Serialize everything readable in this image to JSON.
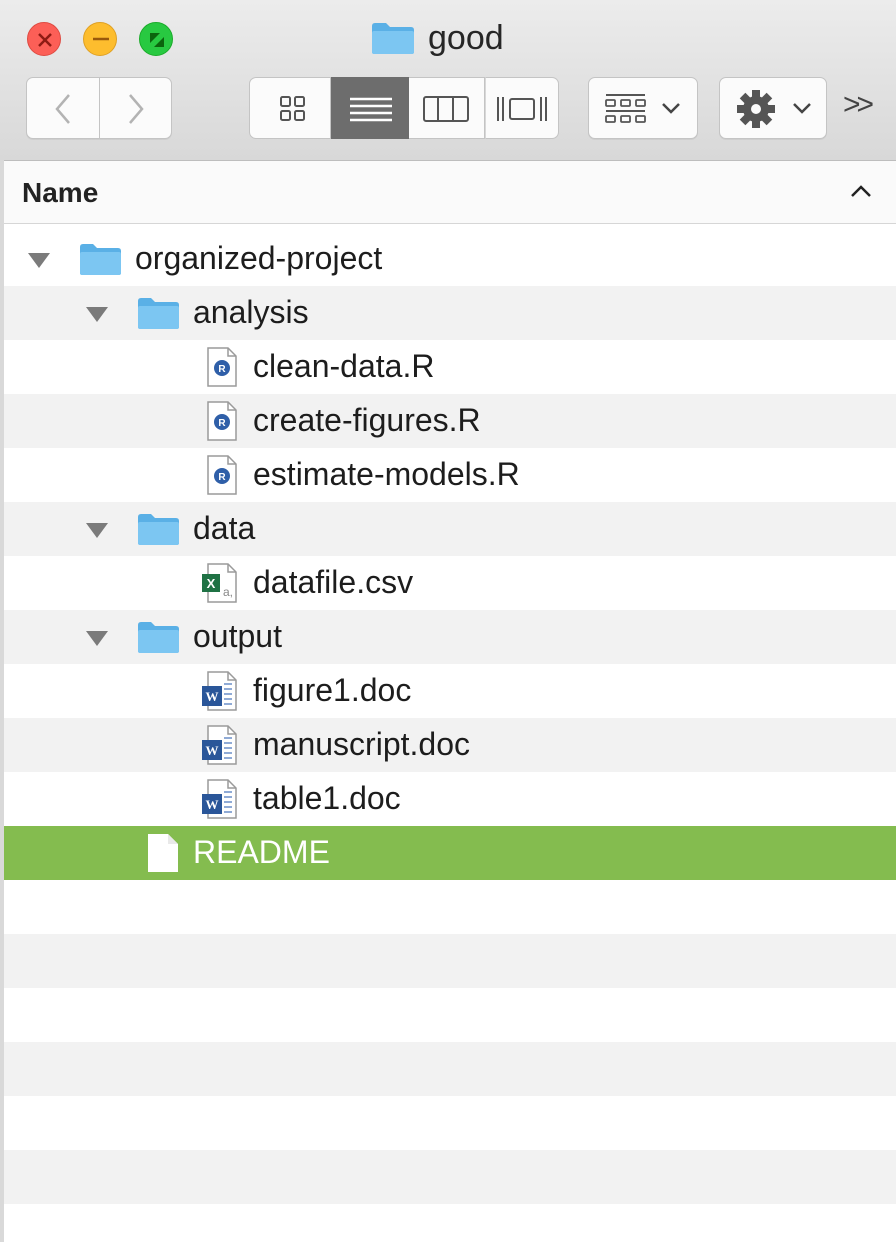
{
  "window": {
    "title": "good",
    "title_icon": "folder-icon",
    "traffic_lights": [
      "close",
      "minimize",
      "zoom"
    ]
  },
  "toolbar": {
    "back_icon": "chevron-left-icon",
    "forward_icon": "chevron-right-icon",
    "view_modes": [
      "icon-view-icon",
      "list-view-icon",
      "column-view-icon",
      "cover-flow-icon"
    ],
    "active_view": "list",
    "arrange_icon": "arrange-grid-icon",
    "action_icon": "gear-icon",
    "overflow": ">>"
  },
  "header": {
    "name_label": "Name",
    "sort_indicator": "^"
  },
  "colors": {
    "selected_row": "#84bc4f",
    "alt_row": "#f2f2f2",
    "folder": "#5ab0e6"
  },
  "rows": [
    {
      "label": "organized-project",
      "type": "folder",
      "level": 0,
      "expanded": true
    },
    {
      "label": "analysis",
      "type": "folder",
      "level": 1,
      "expanded": true
    },
    {
      "label": "clean-data.R",
      "type": "r-file",
      "level": 2
    },
    {
      "label": "create-figures.R",
      "type": "r-file",
      "level": 2
    },
    {
      "label": "estimate-models.R",
      "type": "r-file",
      "level": 2
    },
    {
      "label": "data",
      "type": "folder",
      "level": 1,
      "expanded": true
    },
    {
      "label": "datafile.csv",
      "type": "csv-file",
      "level": 2
    },
    {
      "label": "output",
      "type": "folder",
      "level": 1,
      "expanded": true
    },
    {
      "label": "figure1.doc",
      "type": "word-file",
      "level": 2
    },
    {
      "label": "manuscript.doc",
      "type": "word-file",
      "level": 2
    },
    {
      "label": "table1.doc",
      "type": "word-file",
      "level": 2
    },
    {
      "label": "README",
      "type": "text-file",
      "level": 1,
      "selected": true
    }
  ]
}
